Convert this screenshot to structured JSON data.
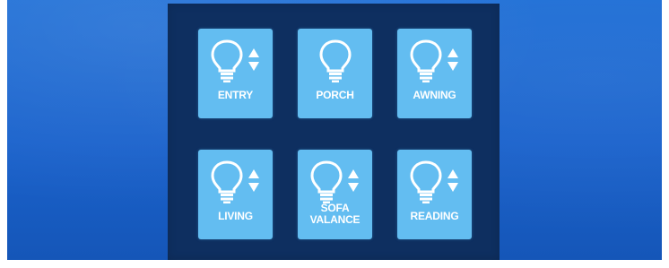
{
  "panel": {
    "tiles": [
      {
        "label": "ENTRY",
        "icon": "light-bulb-icon",
        "dimmer_icon": "up-down-arrows-icon"
      },
      {
        "label": "PORCH",
        "icon": "light-bulb-icon"
      },
      {
        "label": "AWNING",
        "icon": "light-bulb-icon",
        "dimmer_icon": "up-down-arrows-icon"
      },
      {
        "label": "LIVING",
        "icon": "light-bulb-icon",
        "dimmer_icon": "up-down-arrows-icon"
      },
      {
        "label_line1": "SOFA",
        "label_line2": "VALANCE",
        "icon": "light-bulb-icon",
        "dimmer_icon": "up-down-arrows-icon"
      },
      {
        "label": "READING",
        "icon": "light-bulb-icon",
        "dimmer_icon": "up-down-arrows-icon"
      }
    ]
  },
  "colors": {
    "background_blue": "#1f6fd6",
    "panel": "#0e2f60",
    "tile": "#63bdf1",
    "label": "#ffffff"
  }
}
